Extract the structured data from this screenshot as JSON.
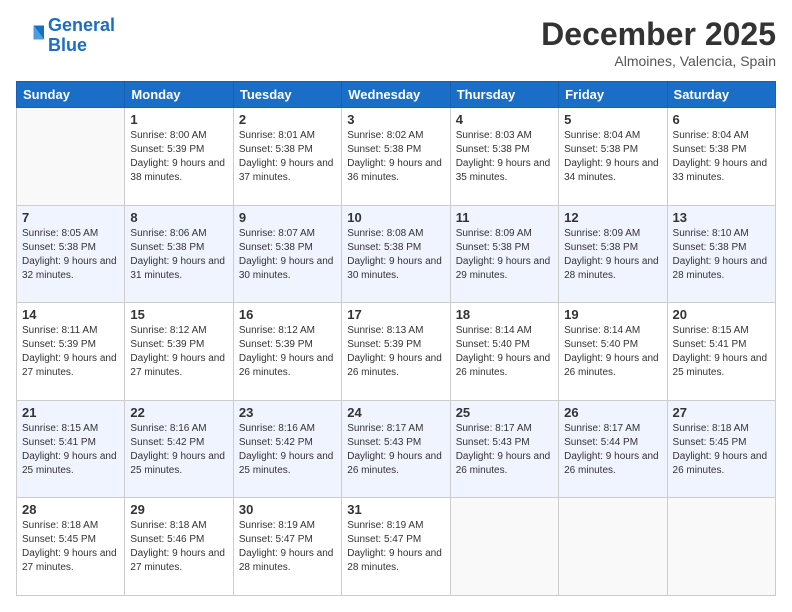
{
  "header": {
    "logo_line1": "General",
    "logo_line2": "Blue",
    "month": "December 2025",
    "location": "Almoines, Valencia, Spain"
  },
  "weekdays": [
    "Sunday",
    "Monday",
    "Tuesday",
    "Wednesday",
    "Thursday",
    "Friday",
    "Saturday"
  ],
  "weeks": [
    [
      {
        "day": "",
        "info": ""
      },
      {
        "day": "1",
        "sunrise": "8:00 AM",
        "sunset": "5:39 PM",
        "daylight": "9 hours and 38 minutes."
      },
      {
        "day": "2",
        "sunrise": "8:01 AM",
        "sunset": "5:38 PM",
        "daylight": "9 hours and 37 minutes."
      },
      {
        "day": "3",
        "sunrise": "8:02 AM",
        "sunset": "5:38 PM",
        "daylight": "9 hours and 36 minutes."
      },
      {
        "day": "4",
        "sunrise": "8:03 AM",
        "sunset": "5:38 PM",
        "daylight": "9 hours and 35 minutes."
      },
      {
        "day": "5",
        "sunrise": "8:04 AM",
        "sunset": "5:38 PM",
        "daylight": "9 hours and 34 minutes."
      },
      {
        "day": "6",
        "sunrise": "8:04 AM",
        "sunset": "5:38 PM",
        "daylight": "9 hours and 33 minutes."
      }
    ],
    [
      {
        "day": "7",
        "sunrise": "8:05 AM",
        "sunset": "5:38 PM",
        "daylight": "9 hours and 32 minutes."
      },
      {
        "day": "8",
        "sunrise": "8:06 AM",
        "sunset": "5:38 PM",
        "daylight": "9 hours and 31 minutes."
      },
      {
        "day": "9",
        "sunrise": "8:07 AM",
        "sunset": "5:38 PM",
        "daylight": "9 hours and 30 minutes."
      },
      {
        "day": "10",
        "sunrise": "8:08 AM",
        "sunset": "5:38 PM",
        "daylight": "9 hours and 30 minutes."
      },
      {
        "day": "11",
        "sunrise": "8:09 AM",
        "sunset": "5:38 PM",
        "daylight": "9 hours and 29 minutes."
      },
      {
        "day": "12",
        "sunrise": "8:09 AM",
        "sunset": "5:38 PM",
        "daylight": "9 hours and 28 minutes."
      },
      {
        "day": "13",
        "sunrise": "8:10 AM",
        "sunset": "5:38 PM",
        "daylight": "9 hours and 28 minutes."
      }
    ],
    [
      {
        "day": "14",
        "sunrise": "8:11 AM",
        "sunset": "5:39 PM",
        "daylight": "9 hours and 27 minutes."
      },
      {
        "day": "15",
        "sunrise": "8:12 AM",
        "sunset": "5:39 PM",
        "daylight": "9 hours and 27 minutes."
      },
      {
        "day": "16",
        "sunrise": "8:12 AM",
        "sunset": "5:39 PM",
        "daylight": "9 hours and 26 minutes."
      },
      {
        "day": "17",
        "sunrise": "8:13 AM",
        "sunset": "5:39 PM",
        "daylight": "9 hours and 26 minutes."
      },
      {
        "day": "18",
        "sunrise": "8:14 AM",
        "sunset": "5:40 PM",
        "daylight": "9 hours and 26 minutes."
      },
      {
        "day": "19",
        "sunrise": "8:14 AM",
        "sunset": "5:40 PM",
        "daylight": "9 hours and 26 minutes."
      },
      {
        "day": "20",
        "sunrise": "8:15 AM",
        "sunset": "5:41 PM",
        "daylight": "9 hours and 25 minutes."
      }
    ],
    [
      {
        "day": "21",
        "sunrise": "8:15 AM",
        "sunset": "5:41 PM",
        "daylight": "9 hours and 25 minutes."
      },
      {
        "day": "22",
        "sunrise": "8:16 AM",
        "sunset": "5:42 PM",
        "daylight": "9 hours and 25 minutes."
      },
      {
        "day": "23",
        "sunrise": "8:16 AM",
        "sunset": "5:42 PM",
        "daylight": "9 hours and 25 minutes."
      },
      {
        "day": "24",
        "sunrise": "8:17 AM",
        "sunset": "5:43 PM",
        "daylight": "9 hours and 26 minutes."
      },
      {
        "day": "25",
        "sunrise": "8:17 AM",
        "sunset": "5:43 PM",
        "daylight": "9 hours and 26 minutes."
      },
      {
        "day": "26",
        "sunrise": "8:17 AM",
        "sunset": "5:44 PM",
        "daylight": "9 hours and 26 minutes."
      },
      {
        "day": "27",
        "sunrise": "8:18 AM",
        "sunset": "5:45 PM",
        "daylight": "9 hours and 26 minutes."
      }
    ],
    [
      {
        "day": "28",
        "sunrise": "8:18 AM",
        "sunset": "5:45 PM",
        "daylight": "9 hours and 27 minutes."
      },
      {
        "day": "29",
        "sunrise": "8:18 AM",
        "sunset": "5:46 PM",
        "daylight": "9 hours and 27 minutes."
      },
      {
        "day": "30",
        "sunrise": "8:19 AM",
        "sunset": "5:47 PM",
        "daylight": "9 hours and 28 minutes."
      },
      {
        "day": "31",
        "sunrise": "8:19 AM",
        "sunset": "5:47 PM",
        "daylight": "9 hours and 28 minutes."
      },
      {
        "day": "",
        "info": ""
      },
      {
        "day": "",
        "info": ""
      },
      {
        "day": "",
        "info": ""
      }
    ]
  ]
}
